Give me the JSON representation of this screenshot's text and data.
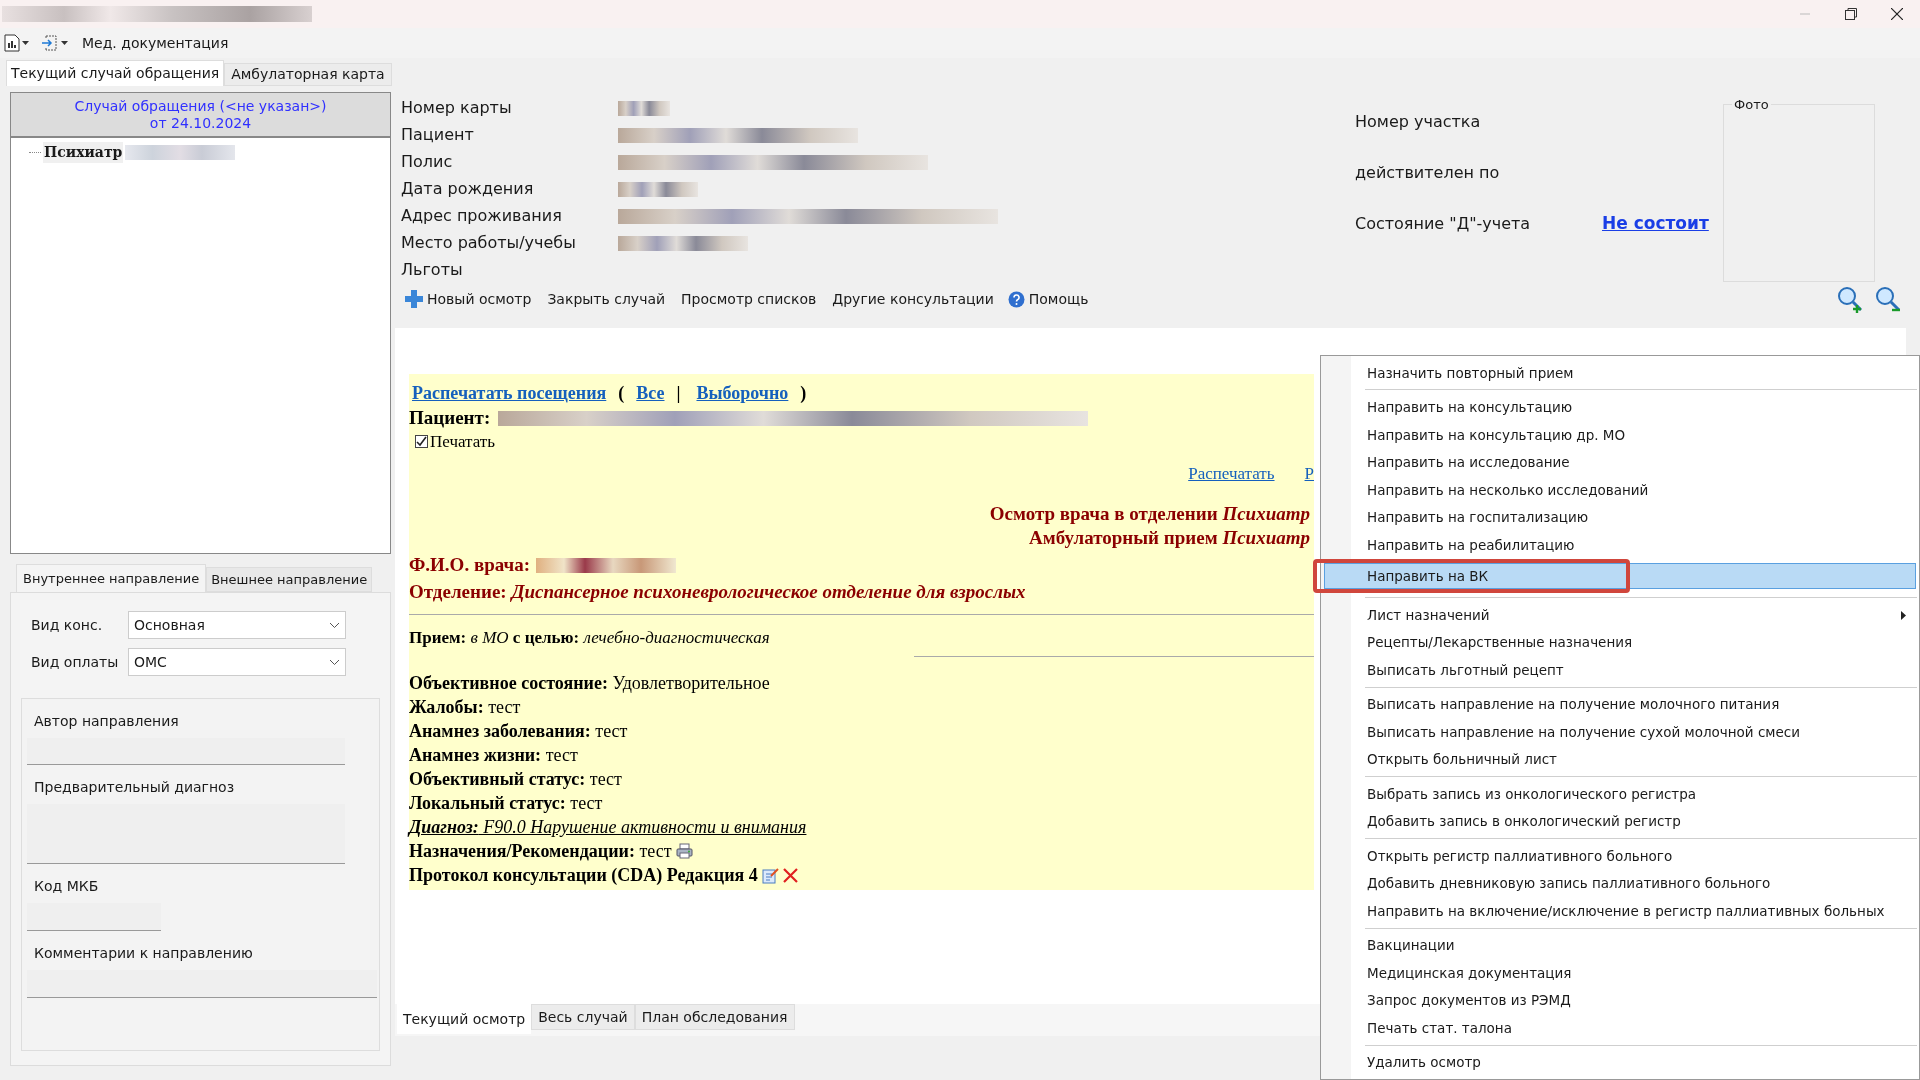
{
  "toolbar": {
    "label": "Мед. документация"
  },
  "main_tabs": [
    {
      "label": "Текущий случай обращения",
      "selected": true
    },
    {
      "label": "Амбулаторная карта",
      "selected": false
    }
  ],
  "case_header": {
    "title": "Случай обращения (<не указан>)",
    "date": "от 24.10.2024"
  },
  "tree": [
    {
      "label": "Психиатр"
    }
  ],
  "referral_tabs": [
    {
      "label": "Внутреннее направление",
      "selected": true
    },
    {
      "label": "Внешнее направление",
      "selected": false
    }
  ],
  "referral_selects": [
    {
      "label": "Вид конс.",
      "value": "Основная"
    },
    {
      "label": "Вид оплаты",
      "value": "ОМС"
    }
  ],
  "referral_fields": [
    {
      "label": "Автор направления",
      "kind": "line"
    },
    {
      "label": "Предварительный диагноз",
      "kind": "area"
    },
    {
      "label": "Код МКБ",
      "kind": "short"
    },
    {
      "label": "Комментарии к направлению",
      "kind": "wide"
    }
  ],
  "patient_info": [
    {
      "label": "Номер карты"
    },
    {
      "label": "Пациент"
    },
    {
      "label": "Полис"
    },
    {
      "label": "Дата рождения"
    },
    {
      "label": "Адрес проживания"
    },
    {
      "label": "Место работы/учебы"
    },
    {
      "label": "Льготы"
    }
  ],
  "district_info": [
    {
      "label": "Номер участка"
    },
    {
      "label": "действителен по"
    },
    {
      "label": "Состояние \"Д\"-учета",
      "link": "Не состоит"
    }
  ],
  "photo": {
    "label": "Фото"
  },
  "actions": [
    {
      "label": "Новый осмотр",
      "kind": "add"
    },
    {
      "label": "Закрыть случай",
      "kind": "plain"
    },
    {
      "label": "Просмотр списков",
      "kind": "plain"
    },
    {
      "label": "Другие консультации",
      "kind": "plain"
    },
    {
      "label": "Помощь",
      "kind": "help"
    }
  ],
  "document": {
    "print_visits": "Распечатать посещения",
    "open_paren": "(",
    "all": "Все",
    "separator": "|",
    "selective": "Выборочно",
    "close_paren": ")",
    "patient_label": "Пациент:",
    "print_checkbox": {
      "label": "Печатать",
      "checked": true
    },
    "print_links": [
      "Распечатать",
      "Р"
    ],
    "headings": [
      "Осмотр врача в отделении *Психиатр*",
      "Амбулаторный прием *Психиатр*"
    ],
    "doctor_label": "Ф.И.О. врача:",
    "department": "Отделение: *Диспансерное психоневрологическое отделение для взрослых*",
    "reception": "**Прием:** *в МО* **с целью:** *лечебно-диагностическая*",
    "lines": [
      {
        "kind": "plain",
        "text": "**Объективное состояние:** Удовлетворительное"
      },
      {
        "kind": "plain",
        "text": "**Жалобы:** тест"
      },
      {
        "kind": "plain",
        "text": "**Анамнез заболевания:** тест"
      },
      {
        "kind": "plain",
        "text": "**Анамнез жизни:** тест"
      },
      {
        "kind": "plain",
        "text": "**Объективный статус:** тест"
      },
      {
        "kind": "plain",
        "text": "**Локальный статус:** тест"
      },
      {
        "kind": "diagnosis",
        "text": "**Диагноз:** F90.0 Нарушение активности и внимания"
      },
      {
        "kind": "printable",
        "text": "**Назначения/Рекомендации:** тест"
      },
      {
        "kind": "protocol",
        "text": "Протокол консультации (CDA) Редакция 4"
      }
    ]
  },
  "bottom_tabs": [
    {
      "label": "Текущий осмотр",
      "selected": true
    },
    {
      "label": "Весь случай",
      "selected": false
    },
    {
      "label": "План обследования",
      "selected": false
    }
  ],
  "context_menu": {
    "groups": [
      [
        {
          "label": "Назначить повторный прием",
          "selected": false,
          "submenu": false
        }
      ],
      [
        {
          "label": "Направить на консультацию",
          "selected": false,
          "submenu": false
        },
        {
          "label": "Направить на консультацию др. МО",
          "selected": false,
          "submenu": false
        },
        {
          "label": "Направить на исследование",
          "selected": false,
          "submenu": false
        },
        {
          "label": "Направить на несколько исследований",
          "selected": false,
          "submenu": false
        },
        {
          "label": "Направить на госпитализацию",
          "selected": false,
          "submenu": false
        },
        {
          "label": "Направить на реабилитацию",
          "selected": false,
          "submenu": false
        },
        {
          "label": "Направить на ВК",
          "selected": true,
          "submenu": false
        }
      ],
      [
        {
          "label": "Лист назначений",
          "selected": false,
          "submenu": true
        },
        {
          "label": "Рецепты/Лекарственные назначения",
          "selected": false,
          "submenu": false
        },
        {
          "label": "Выписать льготный рецепт",
          "selected": false,
          "submenu": false
        }
      ],
      [
        {
          "label": "Выписать направление на получение молочного питания",
          "selected": false,
          "submenu": false
        },
        {
          "label": "Выписать направление на получение сухой молочной смеси",
          "selected": false,
          "submenu": false
        },
        {
          "label": "Открыть больничный лист",
          "selected": false,
          "submenu": false
        }
      ],
      [
        {
          "label": "Выбрать запись из онкологического регистра",
          "selected": false,
          "submenu": false
        },
        {
          "label": "Добавить запись в онкологический регистр",
          "selected": false,
          "submenu": false
        }
      ],
      [
        {
          "label": "Открыть регистр паллиативного больного",
          "selected": false,
          "submenu": false
        },
        {
          "label": "Добавить дневниковую запись паллиативного больного",
          "selected": false,
          "submenu": false
        },
        {
          "label": "Направить на включение/исключение в регистр паллиативных больных",
          "selected": false,
          "submenu": false
        }
      ],
      [
        {
          "label": "Вакцинации",
          "selected": false,
          "submenu": false
        },
        {
          "label": "Медицинская документация",
          "selected": false,
          "submenu": false
        },
        {
          "label": "Запрос документов из РЭМД",
          "selected": false,
          "submenu": false
        },
        {
          "label": "Печать стат. талона",
          "selected": false,
          "submenu": false
        }
      ],
      [
        {
          "label": "Удалить осмотр",
          "selected": false,
          "submenu": false
        }
      ]
    ]
  }
}
